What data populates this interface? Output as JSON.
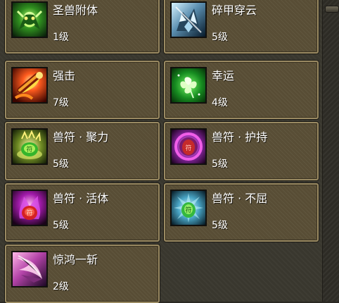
{
  "skills": [
    {
      "name": "圣兽附体",
      "level": "1级",
      "icon": "green-dragon-icon"
    },
    {
      "name": "碎甲穿云",
      "level": "5级",
      "icon": "armored-wolf-icon"
    },
    {
      "name": "强击",
      "level": "7级",
      "icon": "flaming-hammer-icon"
    },
    {
      "name": "幸运",
      "level": "4级",
      "icon": "four-leaf-clover-icon"
    },
    {
      "name": "兽符 · 聚力",
      "level": "5级",
      "icon": "green-rune-stone-icon"
    },
    {
      "name": "兽符 · 护持",
      "level": "5级",
      "icon": "red-rune-purple-orb-icon"
    },
    {
      "name": "兽符 · 活体",
      "level": "5级",
      "icon": "red-rune-magenta-flame-icon"
    },
    {
      "name": "兽符 · 不屈",
      "level": "5级",
      "icon": "green-rune-blue-flame-icon"
    },
    {
      "name": "惊鸿一斩",
      "level": "2级",
      "icon": "pink-wing-slash-icon"
    }
  ]
}
